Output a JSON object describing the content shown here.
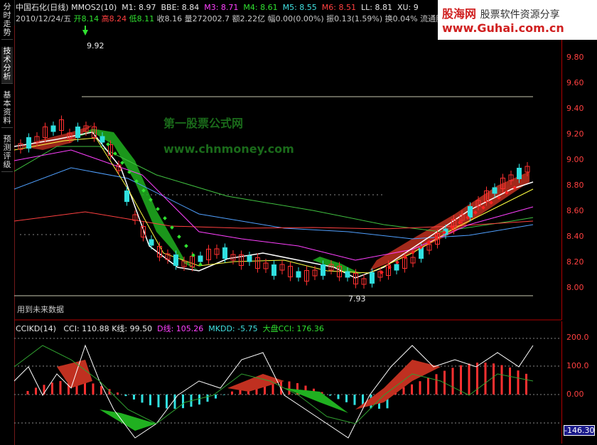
{
  "sidebar": {
    "tabs": [
      "分时走势",
      "技术分析",
      "基本资料",
      "预测评级"
    ]
  },
  "header": {
    "stock": "中国石化(日线)",
    "indicator_name": "MMOS2(10)",
    "m1": "M1: 8.97",
    "bbe": "BBE: 8.84",
    "m3": "M3: 8.71",
    "m4": "M4: 8.61",
    "m5": "M5: 8.55",
    "m6": "M6: 8.51",
    "ll": "LL: 8.81",
    "xu": "XU: 9",
    "date": "2010/12/24/五",
    "open": "开8.14",
    "high": "高8.24",
    "low": "低8.11",
    "close": "收8.16",
    "volume": "量272002.7",
    "amount": "额2.22亿",
    "change": "幅0.00(0.00%)",
    "amplitude": "振0.13(1.59%)",
    "turnover": "换0.04%",
    "float": "流通股"
  },
  "price_axis": [
    "9.80",
    "9.60",
    "9.40",
    "9.20",
    "9.00",
    "8.80",
    "8.60",
    "8.40",
    "8.20",
    "8.00"
  ],
  "labels": {
    "high_point": "9.92",
    "low_point": "7.93",
    "future_data": "用到未来数据"
  },
  "watermark": {
    "brand": "股海网",
    "slogan": "股票软件资源分享",
    "url": "www.Guhai.com.cn"
  },
  "overlay": {
    "line1": "第一股票公式网",
    "line2": "www.chnmoney.com"
  },
  "indicator": {
    "name": "CCIKD(14)",
    "cci": "CCI: 110.88",
    "k": "K线: 99.50",
    "d": "D线: 105.26",
    "mkdd": "MKDD: -5.75",
    "market_cci": "大盘CCI: 176.36",
    "axis": [
      "200.0",
      "100.0",
      "0.00"
    ],
    "current": "-146.30"
  },
  "colors": {
    "up": "#ff3030",
    "down": "#30e0e0",
    "band_green": "#20b020",
    "band_red": "#c03020",
    "axis": "#ff4040"
  }
}
